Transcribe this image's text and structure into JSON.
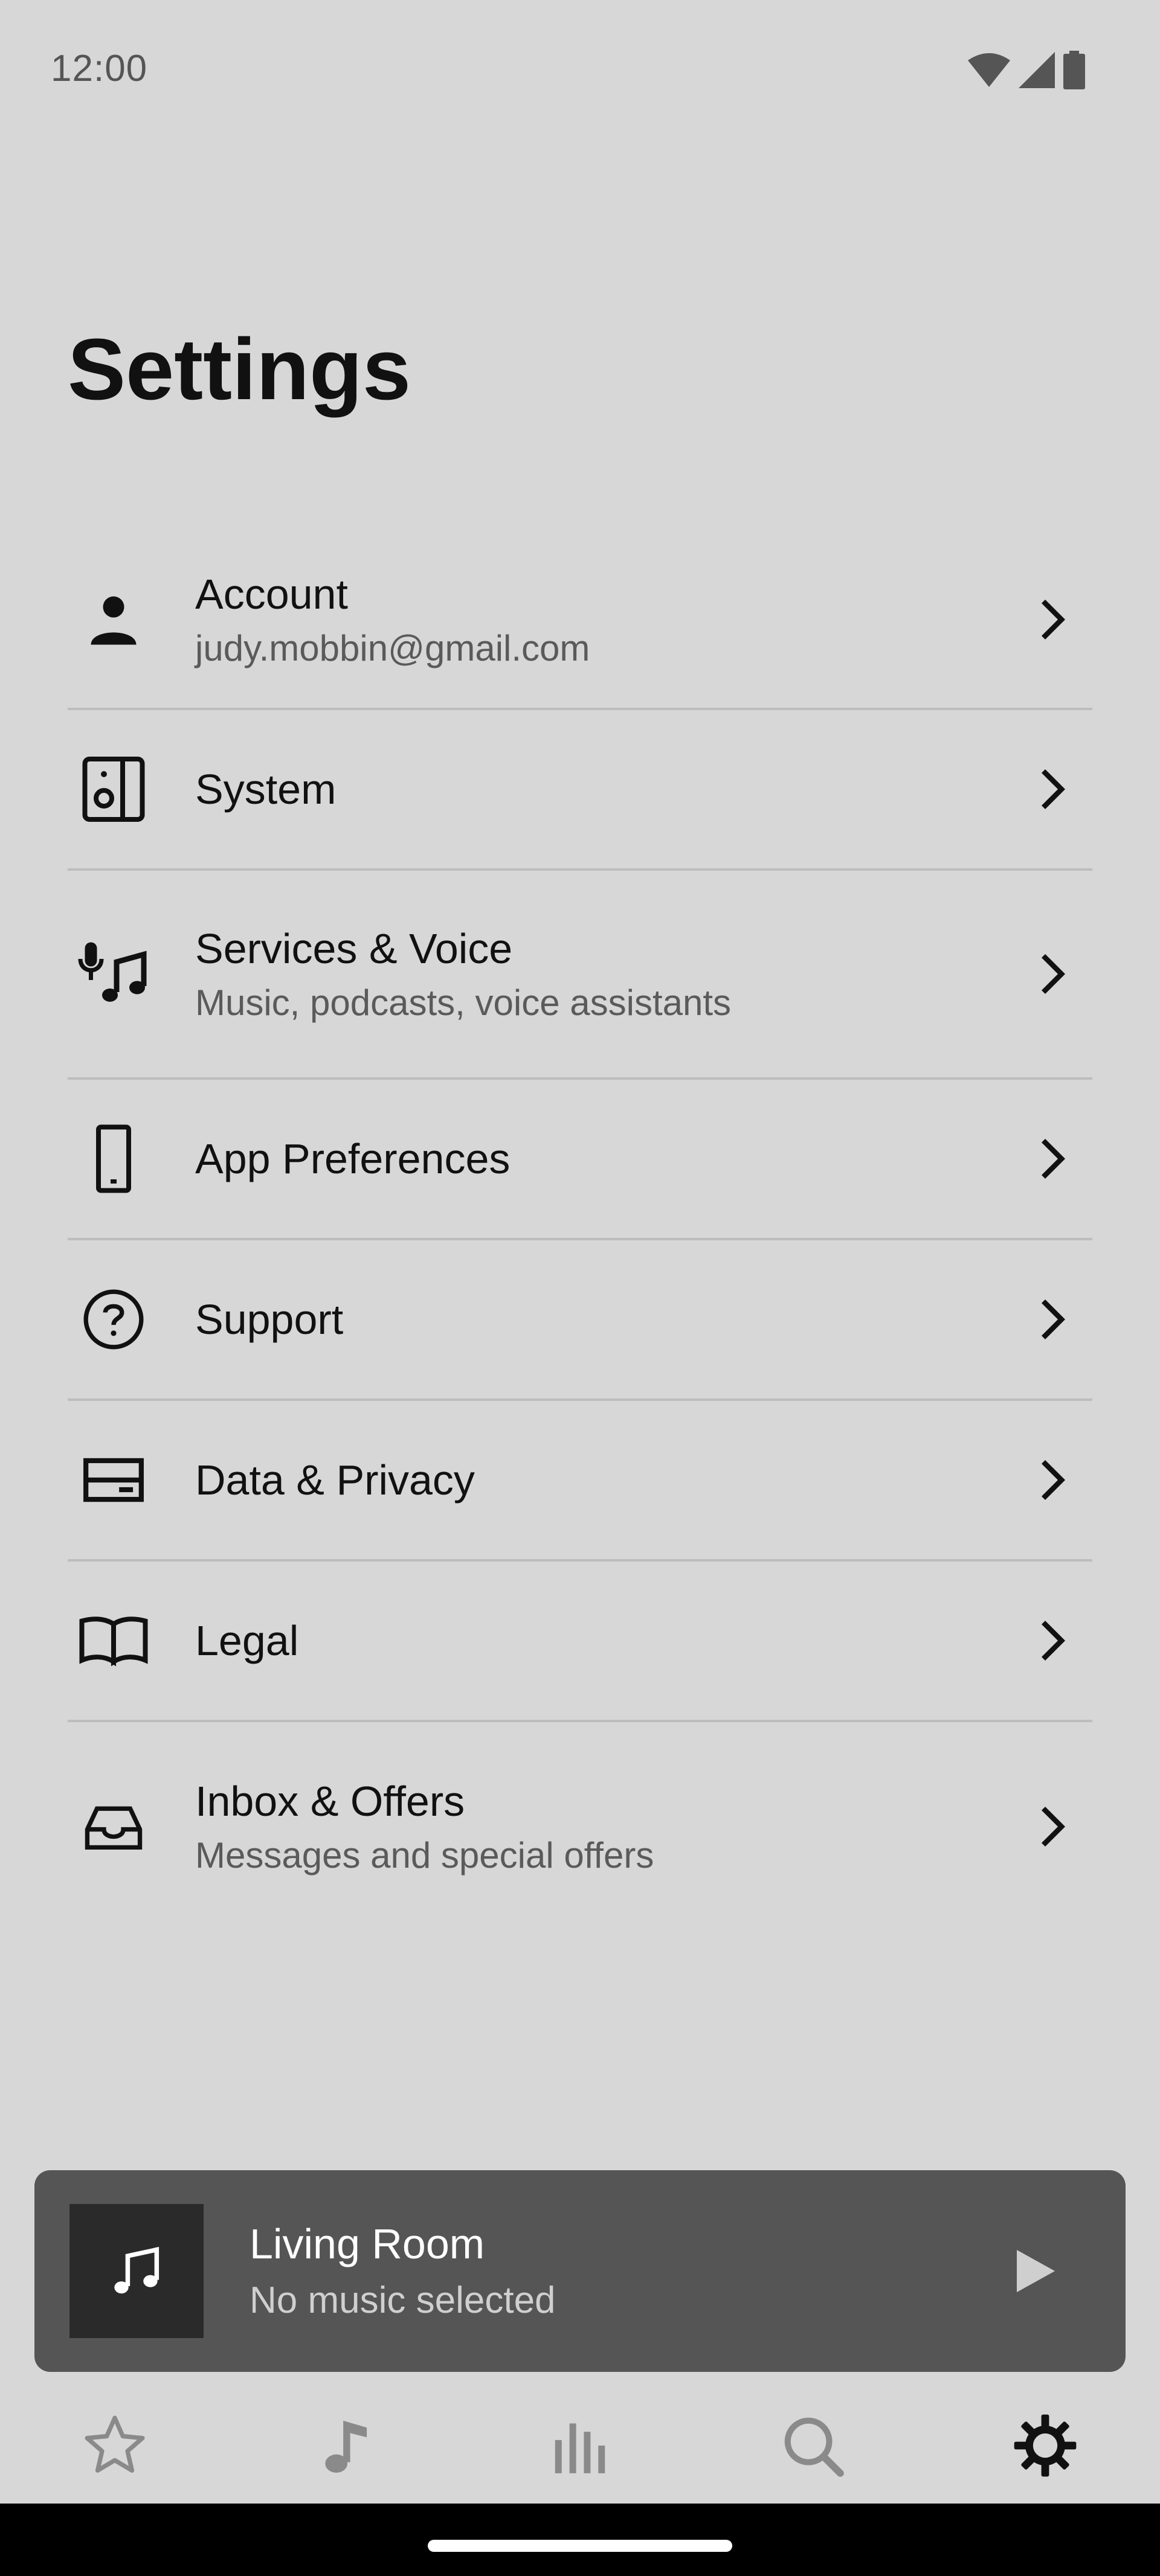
{
  "status_bar": {
    "time": "12:00",
    "icons": [
      "wifi-icon",
      "signal-icon",
      "battery-icon"
    ]
  },
  "page": {
    "title": "Settings"
  },
  "settings_items": [
    {
      "icon": "person-icon",
      "label": "Account",
      "subtitle": "judy.mobbin@gmail.com"
    },
    {
      "icon": "speaker-icon",
      "label": "System",
      "subtitle": ""
    },
    {
      "icon": "mic-music-icon",
      "label": "Services & Voice",
      "subtitle": "Music, podcasts, voice assistants"
    },
    {
      "icon": "phone-icon",
      "label": "App Preferences",
      "subtitle": ""
    },
    {
      "icon": "help-circle-icon",
      "label": "Support",
      "subtitle": ""
    },
    {
      "icon": "card-icon",
      "label": "Data & Privacy",
      "subtitle": ""
    },
    {
      "icon": "book-icon",
      "label": "Legal",
      "subtitle": ""
    },
    {
      "icon": "inbox-icon",
      "label": "Inbox & Offers",
      "subtitle": "Messages and special offers"
    }
  ],
  "now_playing": {
    "room": "Living Room",
    "status": "No music selected"
  },
  "tabs": [
    {
      "icon": "star-icon",
      "active": false
    },
    {
      "icon": "music-note-icon",
      "active": false
    },
    {
      "icon": "equalizer-icon",
      "active": false
    },
    {
      "icon": "search-icon",
      "active": false
    },
    {
      "icon": "gear-icon",
      "active": true
    }
  ],
  "colors": {
    "background": "#d7d7d7",
    "now_playing_bg": "#555555",
    "divider": "#bdbdbd",
    "tab_inactive": "#8a8a8a",
    "tab_active": "#111111"
  }
}
